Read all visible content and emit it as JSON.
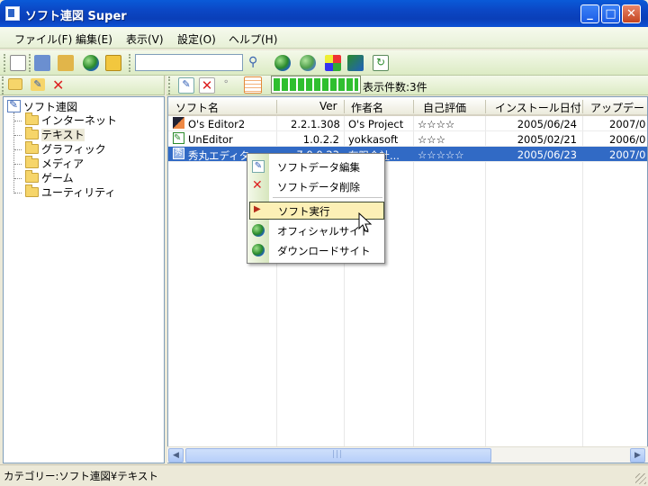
{
  "window": {
    "title": "ソフト連図 Super"
  },
  "menu": [
    "ファイル(F)",
    "編集(E)",
    "表示(V)",
    "設定(O)",
    "ヘルプ(H)"
  ],
  "search": {
    "value": ""
  },
  "status": {
    "count_label": "表示件数:3件",
    "progress": 1.0
  },
  "tree": {
    "root": "ソフト連図",
    "children": [
      "インターネット",
      "テキスト",
      "グラフィック",
      "メディア",
      "ゲーム",
      "ユーティリティ"
    ],
    "selected": "テキスト"
  },
  "list": {
    "columns": [
      "ソフト名",
      "Ver",
      "作者名",
      "自己評価",
      "インストール日付",
      "アップデー"
    ],
    "rows": [
      {
        "name": "O's Editor2",
        "ver": "2.2.1.308",
        "author": "O's Project",
        "rating": "☆☆☆☆",
        "installed": "2005/06/24",
        "updated": "2007/0"
      },
      {
        "name": "UnEditor",
        "ver": "1.0.2.2",
        "author": "yokkasoft",
        "rating": "☆☆☆",
        "installed": "2005/02/21",
        "updated": "2006/0"
      },
      {
        "name": "秀丸エディタ",
        "ver": "7.0.0.23",
        "author": "有限会社...",
        "rating": "☆☆☆☆☆",
        "installed": "2005/06/23",
        "updated": "2007/0"
      }
    ]
  },
  "context_menu": {
    "items": [
      "ソフトデータ編集",
      "ソフトデータ削除",
      "ソフト実行",
      "オフィシャルサイト",
      "ダウンロードサイト"
    ]
  },
  "statusbar": {
    "text": "カテゴリー:ソフト連図¥テキスト"
  },
  "colors": {
    "selection": "#316ac5",
    "menu_hover": "#fcf0b6",
    "toolbar": "#dcebc4"
  }
}
